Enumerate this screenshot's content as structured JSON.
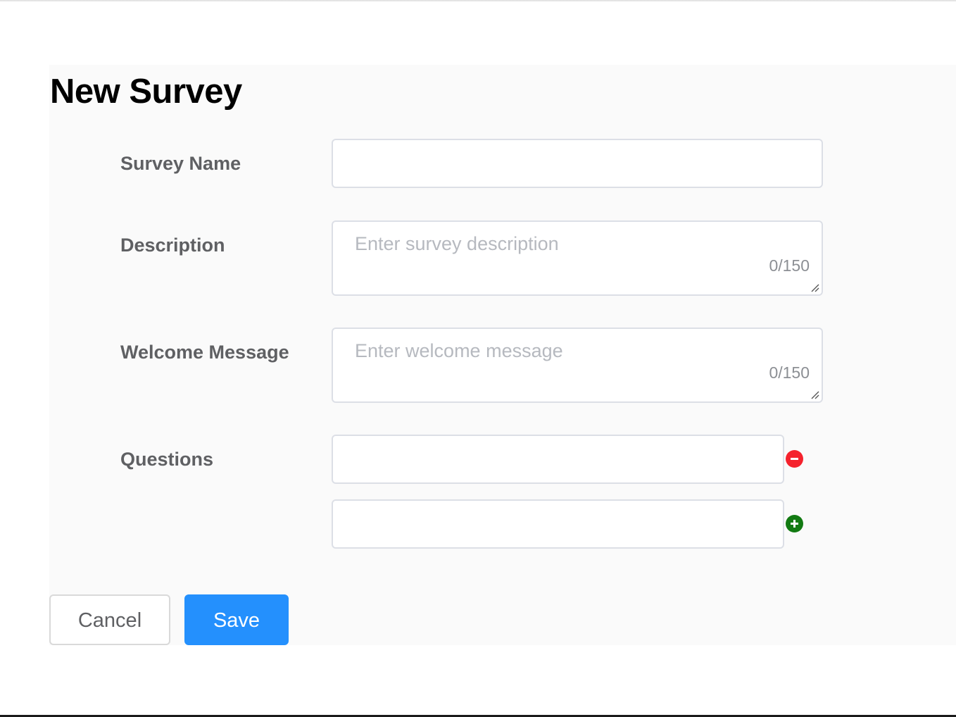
{
  "page": {
    "title": "New Survey"
  },
  "form": {
    "survey_name": {
      "label": "Survey Name",
      "value": ""
    },
    "description": {
      "label": "Description",
      "placeholder": "Enter survey description",
      "counter": "0/150",
      "value": ""
    },
    "welcome_message": {
      "label": "Welcome Message",
      "placeholder": "Enter welcome message",
      "counter": "0/150",
      "value": ""
    },
    "questions": {
      "label": "Questions",
      "items": [
        {
          "value": "",
          "action_icon": "minus-circle-icon"
        },
        {
          "value": "",
          "action_icon": "plus-circle-icon"
        }
      ]
    }
  },
  "actions": {
    "cancel_label": "Cancel",
    "save_label": "Save"
  },
  "colors": {
    "primary": "#2490fd",
    "danger": "#f5222d",
    "success": "#127a12",
    "label_text": "#5f6063",
    "panel_background": "#fafafa",
    "input_border": "#dcdfe6"
  }
}
